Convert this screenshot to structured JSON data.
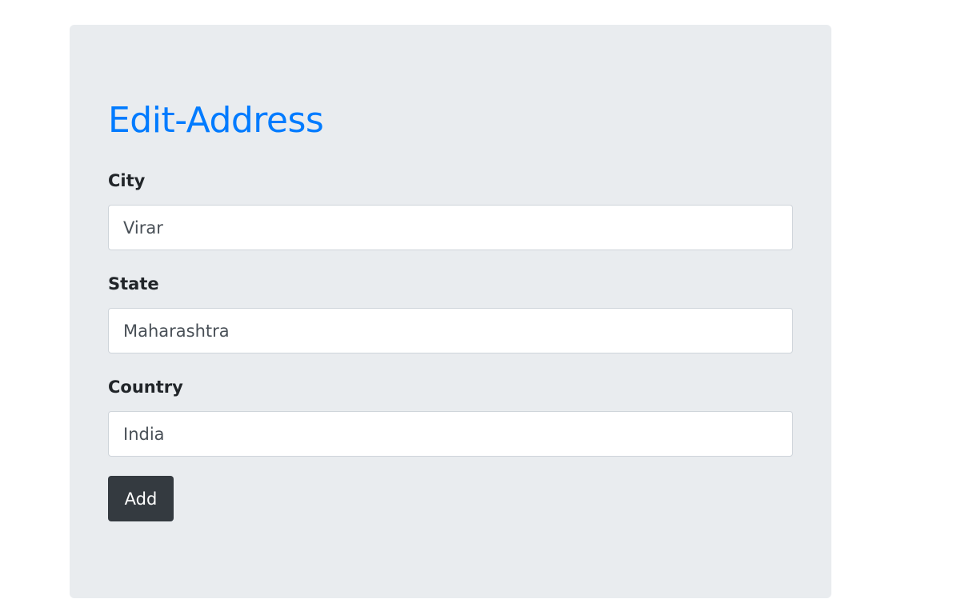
{
  "colors": {
    "title": "#007bff",
    "button_bg": "#343a40",
    "panel_bg": "#e9ecef"
  },
  "form": {
    "title": "Edit-Address",
    "fields": [
      {
        "label": "City",
        "value": "Virar"
      },
      {
        "label": "State",
        "value": "Maharashtra"
      },
      {
        "label": "Country",
        "value": "India"
      }
    ],
    "submit_label": "Add"
  }
}
